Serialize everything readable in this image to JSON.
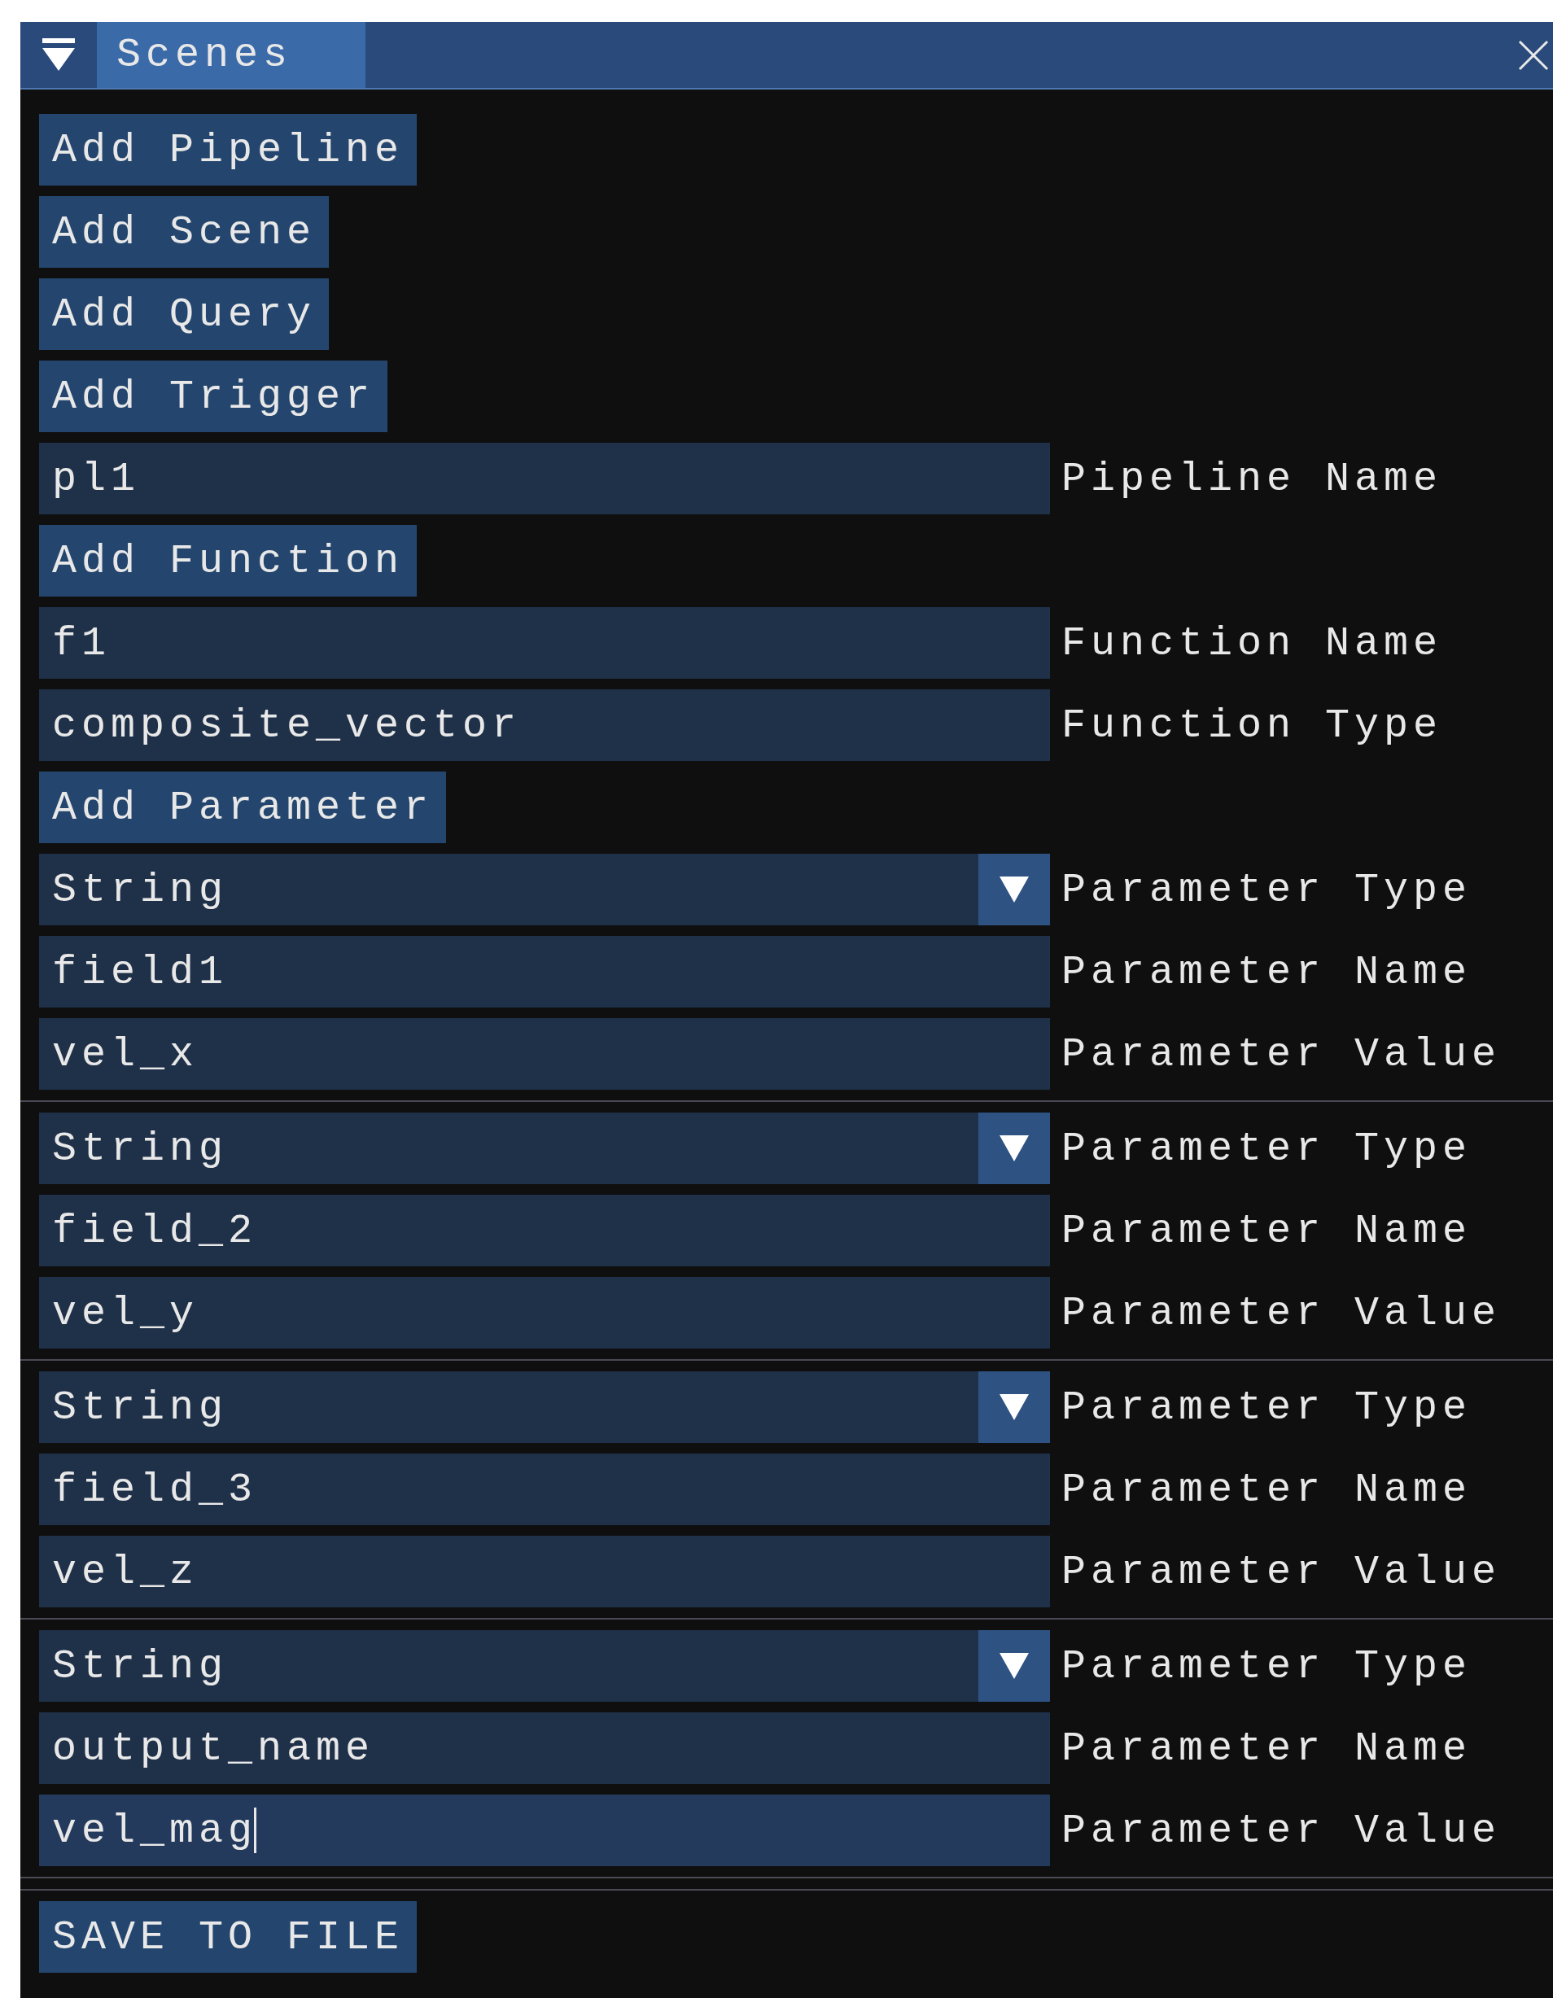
{
  "window": {
    "title": "Scenes",
    "expanded": true
  },
  "items": [
    {
      "kind": "button",
      "text": "Add Pipeline"
    },
    {
      "kind": "button",
      "text": "Add Scene"
    },
    {
      "kind": "button",
      "text": "Add Query"
    },
    {
      "kind": "button",
      "text": "Add Trigger"
    },
    {
      "kind": "field",
      "value": "pl1",
      "label": "Pipeline Name",
      "focused": false
    },
    {
      "kind": "button",
      "text": "Add Function"
    },
    {
      "kind": "field",
      "value": "f1",
      "label": "Function Name",
      "focused": false
    },
    {
      "kind": "field",
      "value": "composite_vector",
      "label": "Function Type",
      "focused": false
    },
    {
      "kind": "button",
      "text": "Add Parameter"
    },
    {
      "kind": "combo",
      "value": "String",
      "label": "Parameter Type"
    },
    {
      "kind": "field",
      "value": "field1",
      "label": "Parameter Name",
      "focused": false
    },
    {
      "kind": "field",
      "value": "vel_x",
      "label": "Parameter Value",
      "focused": false
    },
    {
      "kind": "separator"
    },
    {
      "kind": "combo",
      "value": "String",
      "label": "Parameter Type"
    },
    {
      "kind": "field",
      "value": "field_2",
      "label": "Parameter Name",
      "focused": false
    },
    {
      "kind": "field",
      "value": "vel_y",
      "label": "Parameter Value",
      "focused": false
    },
    {
      "kind": "separator"
    },
    {
      "kind": "combo",
      "value": "String",
      "label": "Parameter Type"
    },
    {
      "kind": "field",
      "value": "field_3",
      "label": "Parameter Name",
      "focused": false
    },
    {
      "kind": "field",
      "value": "vel_z",
      "label": "Parameter Value",
      "focused": false
    },
    {
      "kind": "separator"
    },
    {
      "kind": "combo",
      "value": "String",
      "label": "Parameter Type"
    },
    {
      "kind": "field",
      "value": "output_name",
      "label": "Parameter Name",
      "focused": false
    },
    {
      "kind": "field",
      "value": "vel_mag",
      "label": "Parameter Value",
      "focused": true
    },
    {
      "kind": "separator"
    },
    {
      "kind": "separator"
    },
    {
      "kind": "button",
      "text": "SAVE TO FILE"
    }
  ]
}
